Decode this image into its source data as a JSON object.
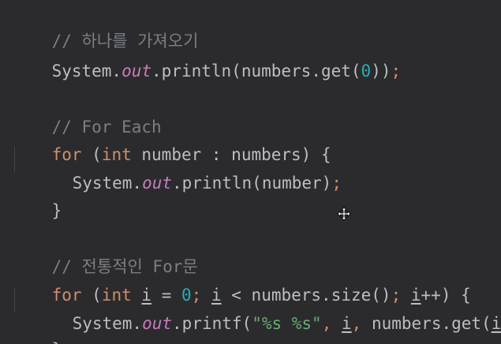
{
  "code": {
    "line1": {
      "comment": "// 하나를 가져오기"
    },
    "line2": {
      "a": "System.",
      "field": "out",
      "b": ".println(numbers.get(",
      "num": "0",
      "c": "))",
      "semi": ";"
    },
    "line4": {
      "comment": "// For Each"
    },
    "line5": {
      "kw1": "for",
      "a": " (",
      "kw2": "int",
      "b": " number : numbers) {"
    },
    "line6": {
      "a": "System.",
      "field": "out",
      "b": ".println(number)",
      "semi": ";"
    },
    "line7": {
      "a": "}"
    },
    "line9": {
      "comment": "// 전통적인 For문"
    },
    "line10": {
      "kw1": "for",
      "a": " (",
      "kw2": "int",
      "sp": " ",
      "v1": "i",
      "b": " = ",
      "num": "0",
      "semi1": ";",
      "sp2": " ",
      "v2": "i",
      "c": " < numbers.size()",
      "semi2": ";",
      "sp3": " ",
      "v3": "i",
      "d": "++) {"
    },
    "line11": {
      "a": "System.",
      "field": "out",
      "b": ".printf(",
      "str": "\"%s %s\"",
      "comma1": ",",
      "sp": " ",
      "v1": "i",
      "comma2": ",",
      "c": " numbers.get(",
      "v2": "i",
      "d": "))",
      "semi": ";"
    },
    "line12": {
      "a": "}"
    }
  },
  "colors": {
    "background": "#2b2b2d",
    "keyword": "#cf8e6d",
    "comment": "#7a7e85",
    "field": "#c77dbb",
    "number": "#2aacb8",
    "string": "#6aab73",
    "text": "#bcbec4"
  },
  "icons": {
    "cursor": "move-cursor-icon"
  }
}
